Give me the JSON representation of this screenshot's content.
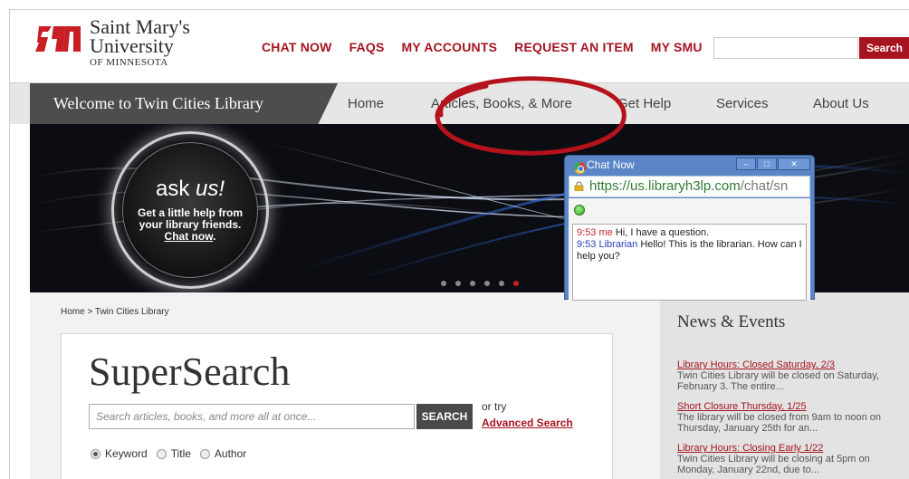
{
  "logo": {
    "line1": "Saint Mary's",
    "line2": "University",
    "line3": "OF MINNESOTA"
  },
  "topnav": {
    "items": [
      "CHAT NOW",
      "FAQS",
      "MY ACCOUNTS",
      "REQUEST AN ITEM",
      "MY SMU"
    ],
    "search_button": "Search"
  },
  "navbar": {
    "welcome": "Welcome to Twin Cities Library",
    "items": [
      "Home",
      "Articles, Books, & More",
      "Get Help",
      "Services",
      "About Us"
    ]
  },
  "banner": {
    "ask_title": "ask",
    "ask_title_em": "us!",
    "ask_line1": "Get a little help from",
    "ask_line2": "your library friends.",
    "ask_link": "Chat now",
    "ask_link_suffix": ".",
    "slides_total": 6,
    "slide_active": 6
  },
  "chat_window": {
    "title": "Chat Now",
    "url_host": "https://us.libraryh3lp.com",
    "url_path": "/chat/sn",
    "messages": [
      {
        "time": "9:53",
        "sender": "me",
        "text": "Hi, I have a question."
      },
      {
        "time": "9:53",
        "sender": "Librarian",
        "text": "Hello! This is the librarian. How can I help you?"
      }
    ]
  },
  "content": {
    "breadcrumb": "Home > Twin Cities Library",
    "supersearch": {
      "title": "SuperSearch",
      "placeholder": "Search articles, books, and more all at once...",
      "button": "SEARCH",
      "or_try": "or try",
      "advanced": "Advanced Search",
      "options": [
        {
          "label": "Keyword",
          "selected": true
        },
        {
          "label": "Title",
          "selected": false
        },
        {
          "label": "Author",
          "selected": false
        }
      ]
    }
  },
  "news": {
    "title": "News & Events",
    "items": [
      {
        "link": "Library Hours: Closed Saturday, 2/3",
        "text": "Twin Cities Library will be closed on Saturday, February 3.  The entire..."
      },
      {
        "link": "Short Closure Thursday, 1/25",
        "text": "The library will be closed from 9am to noon on Thursday, January 25th for an..."
      },
      {
        "link": "Library Hours: Closing Early 1/22",
        "text": "Twin Cities Library will be closing at 5pm on Monday, January 22nd, due to..."
      }
    ]
  },
  "colors": {
    "brand_red": "#a6141f",
    "annotation_red": "#b5121b",
    "chat_blue": "#5a86c8"
  }
}
